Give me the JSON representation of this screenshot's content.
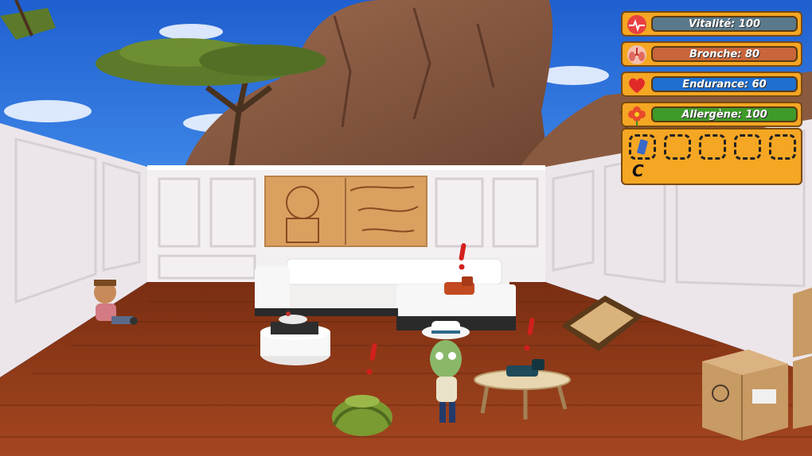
{
  "hud": {
    "stats": [
      {
        "label": "Vitalité: 100",
        "icon": "heart-pulse-icon",
        "value": 100,
        "color": "#5a7a8c"
      },
      {
        "label": "Bronche: 80",
        "icon": "lungs-icon",
        "value": 80,
        "color": "#c8653a"
      },
      {
        "label": "Endurance: 60",
        "icon": "heart-icon",
        "value": 60,
        "color": "#1f6fd0"
      },
      {
        "label": "Allergène: 100",
        "icon": "flower-icon",
        "value": 100,
        "color": "#3f9a2a"
      }
    ],
    "inventory": {
      "slot_count": 5,
      "filled_slots": 1,
      "first_item_icon": "inhaler-icon",
      "letter": "C"
    }
  },
  "scene": {
    "colors": {
      "sky": "#2a6fd6",
      "floor": "#8a3a1a",
      "wall": "#f2eef0",
      "hud": "#f5a623"
    },
    "alerts": [
      "exclamation-icon",
      "exclamation-icon",
      "exclamation-icon",
      "exclamation-icon"
    ]
  }
}
